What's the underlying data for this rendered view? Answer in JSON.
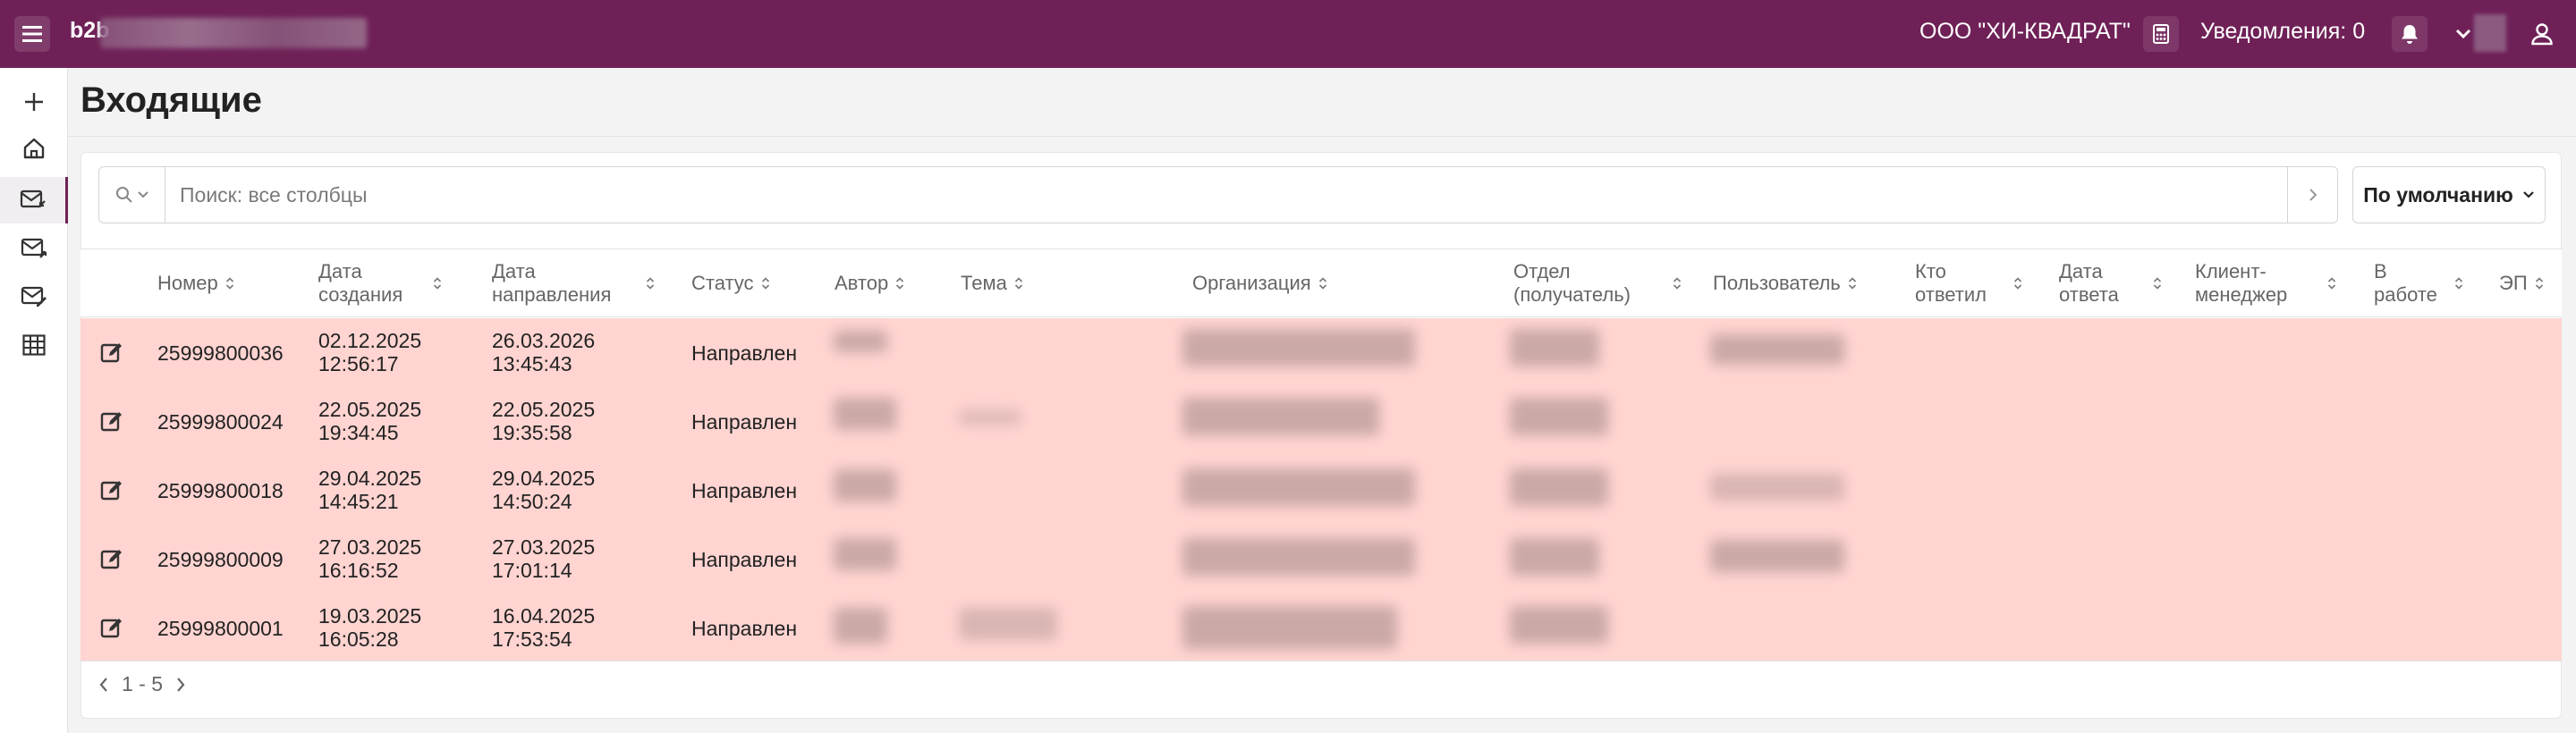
{
  "header": {
    "brand": "b2b",
    "organization": "ООО \"ХИ-КВАДРАТ\"",
    "notifications_label": "Уведомления: 0"
  },
  "page": {
    "title": "Входящие"
  },
  "search": {
    "placeholder": "Поиск: все столбцы",
    "sort_label": "По умолчанию"
  },
  "table": {
    "columns": [
      "Номер",
      "Дата создания",
      "Дата направления",
      "Статус",
      "Автор",
      "Тема",
      "Организация",
      "Отдел (получатель)",
      "Пользователь",
      "Кто ответил",
      "Дата ответа",
      "Клиент-менеджер",
      "В работе",
      "ЭП"
    ],
    "rows": [
      {
        "number": "25999800036",
        "created_date": "02.12.2025",
        "created_time": "12:56:17",
        "sent_date": "26.03.2026",
        "sent_time": "13:45:43",
        "status": "Направлен"
      },
      {
        "number": "25999800024",
        "created_date": "22.05.2025",
        "created_time": "19:34:45",
        "sent_date": "22.05.2025",
        "sent_time": "19:35:58",
        "status": "Направлен"
      },
      {
        "number": "25999800018",
        "created_date": "29.04.2025",
        "created_time": "14:45:21",
        "sent_date": "29.04.2025",
        "sent_time": "14:50:24",
        "status": "Направлен"
      },
      {
        "number": "25999800009",
        "created_date": "27.03.2025",
        "created_time": "16:16:52",
        "sent_date": "27.03.2025",
        "sent_time": "17:01:14",
        "status": "Направлен"
      },
      {
        "number": "25999800001",
        "created_date": "19.03.2025",
        "created_time": "16:05:28",
        "sent_date": "16.04.2025",
        "sent_time": "17:53:54",
        "status": "Направлен"
      }
    ]
  },
  "pagination": {
    "range": "1 - 5"
  },
  "colors": {
    "header_bg": "#6f2157",
    "row_highlight": "#ffd4d1"
  }
}
